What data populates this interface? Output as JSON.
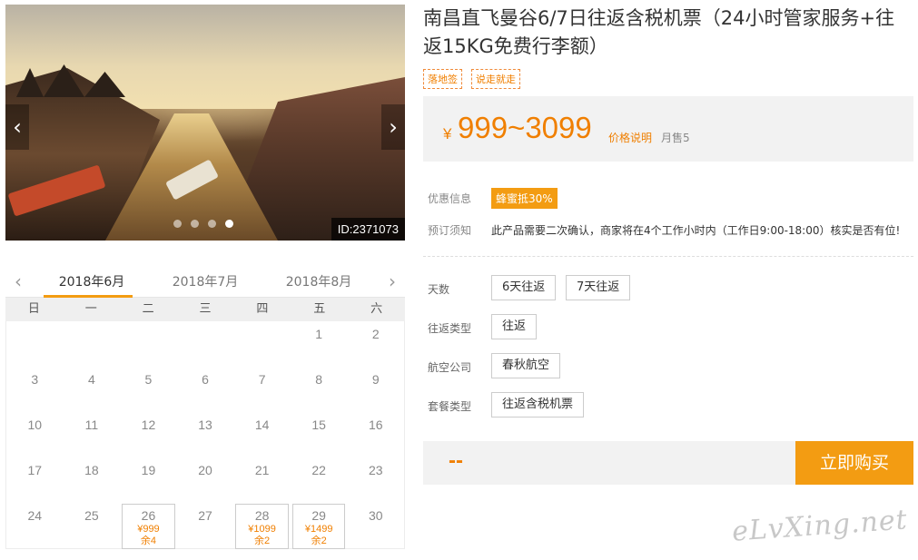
{
  "gallery": {
    "prev_icon": "‹",
    "next_icon": "›",
    "image_id": "ID:2371073",
    "dots": 4,
    "active_dot": 3
  },
  "calendar": {
    "prev_icon": "‹",
    "next_icon": "›",
    "months": [
      "2018年6月",
      "2018年7月",
      "2018年8月"
    ],
    "selected_month": 0,
    "weekdays": [
      "日",
      "一",
      "二",
      "三",
      "四",
      "五",
      "六"
    ],
    "weeks": [
      [
        {
          "d": ""
        },
        {
          "d": ""
        },
        {
          "d": ""
        },
        {
          "d": ""
        },
        {
          "d": ""
        },
        {
          "d": "1"
        },
        {
          "d": "2"
        }
      ],
      [
        {
          "d": "3"
        },
        {
          "d": "4"
        },
        {
          "d": "5"
        },
        {
          "d": "6"
        },
        {
          "d": "7"
        },
        {
          "d": "8"
        },
        {
          "d": "9"
        }
      ],
      [
        {
          "d": "10"
        },
        {
          "d": "11"
        },
        {
          "d": "12"
        },
        {
          "d": "13"
        },
        {
          "d": "14"
        },
        {
          "d": "15"
        },
        {
          "d": "16"
        }
      ],
      [
        {
          "d": "17"
        },
        {
          "d": "18"
        },
        {
          "d": "19"
        },
        {
          "d": "20"
        },
        {
          "d": "21"
        },
        {
          "d": "22"
        },
        {
          "d": "23"
        }
      ],
      [
        {
          "d": "24"
        },
        {
          "d": "25"
        },
        {
          "d": "26",
          "price": "¥999",
          "stock": "余4"
        },
        {
          "d": "27"
        },
        {
          "d": "28",
          "price": "¥1099",
          "stock": "余2"
        },
        {
          "d": "29",
          "price": "¥1499",
          "stock": "余2"
        },
        {
          "d": "30"
        }
      ]
    ]
  },
  "product": {
    "title": "南昌直飞曼谷6/7日往返含税机票（24小时管家服务+往返15KG免费行李额）",
    "tags": [
      "落地签",
      "说走就走"
    ],
    "price_symbol": "¥",
    "price_range": "999~3099",
    "price_explain": "价格说明",
    "monthly_sales": "月售5"
  },
  "info": {
    "promo_label": "优惠信息",
    "promo_value": "蜂蜜抵30%",
    "notice_label": "预订须知",
    "notice_value": "此产品需要二次确认，商家将在4个工作小时内（工作日9:00-18:00）核实是否有位!"
  },
  "options": {
    "days_label": "天数",
    "days": [
      "6天往返",
      "7天往返"
    ],
    "trip_type_label": "往返类型",
    "trip_type": [
      "往返"
    ],
    "airline_label": "航空公司",
    "airline": [
      "春秋航空"
    ],
    "package_label": "套餐类型",
    "package": [
      "往返含税机票"
    ]
  },
  "buy": {
    "quantity_display": "--",
    "buy_label": "立即购买"
  },
  "watermark": "eLvXing.net",
  "colors": {
    "accent": "#f39c12",
    "price": "#f07f00"
  }
}
